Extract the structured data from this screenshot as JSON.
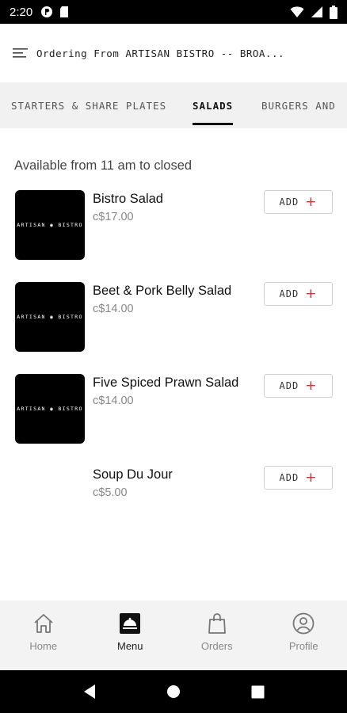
{
  "status_bar": {
    "time": "2:20"
  },
  "header": {
    "title": "Ordering From ARTISAN BISTRO -- BROA..."
  },
  "tabs": [
    {
      "label": "STARTERS & SHARE PLATES",
      "active": false
    },
    {
      "label": "SALADS",
      "active": true
    },
    {
      "label": "BURGERS AND",
      "active": false
    }
  ],
  "availability": "Available from 11 am to closed",
  "thumbnail_text": "ARTISAN ◉ BISTRO",
  "items": [
    {
      "name": "Bistro Salad",
      "price": "c$17.00",
      "has_image": true,
      "add_label": "ADD"
    },
    {
      "name": "Beet & Pork Belly Salad",
      "price": "c$14.00",
      "has_image": true,
      "add_label": "ADD"
    },
    {
      "name": "Five Spiced Prawn Salad",
      "price": "c$14.00",
      "has_image": true,
      "add_label": "ADD"
    },
    {
      "name": "Soup Du Jour",
      "price": "c$5.00",
      "has_image": false,
      "add_label": "ADD"
    }
  ],
  "add_icon": "+",
  "colors": {
    "accent": "#d32f2f",
    "tab_bar_bg": "#f1f1f1",
    "bottom_nav_bg": "#f3f3f3"
  },
  "bottom_nav": [
    {
      "label": "Home",
      "icon": "home-icon",
      "active": false
    },
    {
      "label": "Menu",
      "icon": "menu-icon",
      "active": true
    },
    {
      "label": "Orders",
      "icon": "shopping-bag-icon",
      "active": false
    },
    {
      "label": "Profile",
      "icon": "profile-icon",
      "active": false
    }
  ]
}
